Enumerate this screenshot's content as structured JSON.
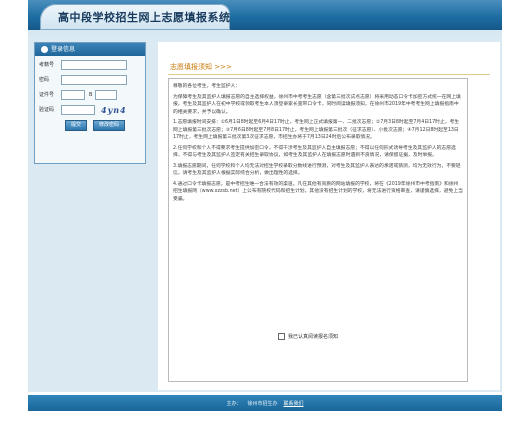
{
  "header": {
    "title": "高中段学校招生网上志愿填报系统"
  },
  "login": {
    "heading": "登录信息",
    "fields": [
      {
        "label": "考籍号"
      },
      {
        "label": "密码"
      }
    ],
    "id_label": "证件号",
    "id_mid": "B",
    "code_label": "验证码",
    "captcha": "4yn4",
    "login_button": "提交",
    "change_pwd_button": "修改密码"
  },
  "notice": {
    "title": "志愿填报须知 >>>",
    "paragraphs": [
      "尊敬的各位考生，考生监护人：",
      "为保障考生及其监护人填报志愿的自主选择权益，徐州市中考考生志愿（含第三批次试点志愿）将采用动态口令卡加密方式统一在网上填报。考生及其监护人在初中学校或领取考生本人须登录家长宽带口令卡，同时阅读填报须知，在徐州市2019年中考考生网上填报指南中的相关要求，并予以确认。",
      "1.志愿填报时间安排：①6月1日8时起至6月4日17时止，考生网上正式填报第一、二批次志愿；②7月3日8时起至7月4日17时止，考生网上填报第三批次志愿；③7月6日8时起至7月8日17时止，考生网上填报第三批次（征求志愿）、小批次志愿；④7月12日8时起至13日17时止，考生网上填报第三批次第3次征求志愿，市招生办将于7月13日24时后公布录取情况。",
      "2.任何学校和个人不得要求考生提供加密口令，不得干涉考生及其监护人自主填报志愿；不得以任何形式诱导考生及其监护人的志愿选择，不得与考生及其监护人签定有关招生录取协议，如考生及其监护人在填报志愿时遇到不良情况，请保留证据，及时举报。",
      "3.填报志愿期间，任何学校和个人均无法对招生学校录取分数线进行预测，对考生及其监护人表达的承诺或猜测，均为无效行为，不要轻信，请考生及其监护人根据实际综合分析，做出理性的选择。",
      "4.通过口令卡填报志愿，是中考招生唯一合法有效的渠道。凡在其他有资质的网站填报的学校，将在《2019年徐州市中考指南》和徐州招生填报网（www.xzzsb.net）上公布有院校代码和招生计划，其他没有招生计划的学校，将无法进行资格审查，请谨慎选择，避免上当受骗。"
    ],
    "agree_label": "我已认真阅读报名须知"
  },
  "footer": {
    "host_label": "主办：",
    "host_name": "徐州市招生办",
    "link_label": "联系我们"
  }
}
